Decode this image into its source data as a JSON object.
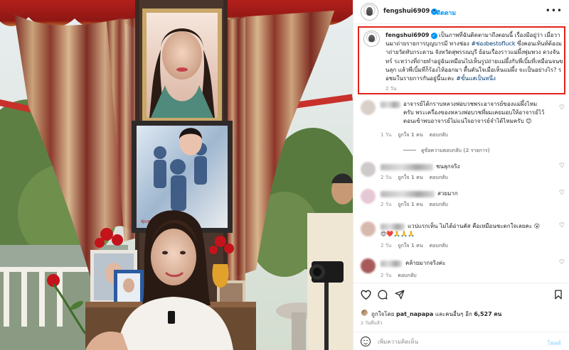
{
  "post": {
    "username": "fengshui6909",
    "verified_mark": "✓",
    "separator": "•",
    "follow_label": "ติดตาม",
    "more_icon": "more-options-icon"
  },
  "caption": {
    "username": "fengshui6909",
    "text_1": "เป็นภาพที่ฉันติดตามาถึงตอนนี้ เรื่องมีอยู่ว่า เมื่อวานมาถ่ายรายการบุญบารมี ทางช่อง ",
    "tag_1": "#ช่องbestofluck",
    "text_2": " ซึ่งคอนเท้นท์ต้องมาถ่ายวัดทับกระดาน จังหวัดสุพรรณบุรี ย้อนเรื่องราวแม่ผึ้งพุ่มพวง ดวงจันทร์ ระหว่างที่ถ่ายทำอยู่ฉันเหมือนไปเห็นรูปถ่ายแม่ผึ้งกับพี่เบิ้มที่เหมือนจนขนลุก แล้วพี่เบิ้มที่ก็ร้องไห้ออกมา ตื้นตันใจเมื่อเห็นแม่ผึ้ง จะเป็นอย่างไร? รอชมในรายการกันอยู่นี้นะคะ ",
    "tag_2": "#ขั้นแสเป็นหนึ่ง",
    "time": "2 วัน"
  },
  "comments": [
    {
      "text": "อาจารย์ได้กราบหลวงพ่อบวชพระอาจารย์ของแม่ผึ้งไหมครับ พระเครื่องของหลวงพ่อบวชที่ผมเคยมอบให้อาจารย์ไว้ตอนเข้าพบอาจารย์ไม่แน่ใจอาจารย์จำได้ไหมครับ 😊",
      "time": "1 วัน",
      "likes": "ถูกใจ 1 คน",
      "reply": "ตอบกลับ",
      "view_replies": "ดูข้อความตอบกลับ (2 รายการ)",
      "avatar_color": "#d9cfc9"
    },
    {
      "text": "ชนลุกจริง",
      "time": "2 วัน",
      "likes": "ถูกใจ 1 คน",
      "reply": "ตอบกลับ",
      "avatar_color": "#cfcaca"
    },
    {
      "text": "สวยมาก",
      "time": "2 วัน",
      "likes": "ถูกใจ 1 คน",
      "reply": "ตอบกลับ",
      "avatar_color": "#e6c7d4"
    },
    {
      "text": "แวปแรกเห็น ไม่ได้อ่านคัส คือเหมือนชะตกใจเลยคะ 😮",
      "emojis": "😍❤️🙏🙏🙏",
      "time": "2 วัน",
      "likes": "ถูกใจ 1 คน",
      "reply": "ตอบกลับ",
      "avatar_color": "#d8b9ad"
    },
    {
      "text": "คล้ายมากจริงค่ะ",
      "time": "2 วัน",
      "reply": "ตอบกลับ",
      "avatar_color": "#a85a5a"
    }
  ],
  "actions": {
    "like_icon": "heart-icon",
    "comment_icon": "comment-icon",
    "share_icon": "share-icon",
    "save_icon": "bookmark-icon"
  },
  "likes": {
    "prefix": "ถูกใจโดย ",
    "user": "pat_napapa",
    "middle": " และคนอื่นๆ อีก ",
    "count": "6,527 คน"
  },
  "posted_ago": "2 วันที่แล้ว",
  "add_comment": {
    "placeholder": "เพิ่มความคิดเห็น",
    "post_label": "โพสต์"
  },
  "photo": {
    "frame_text": "พุ่มพวง"
  },
  "colors": {
    "accent": "#0095f6",
    "highlight_box": "#e2231a",
    "tag": "#00376b",
    "muted": "#8e8e8e"
  }
}
